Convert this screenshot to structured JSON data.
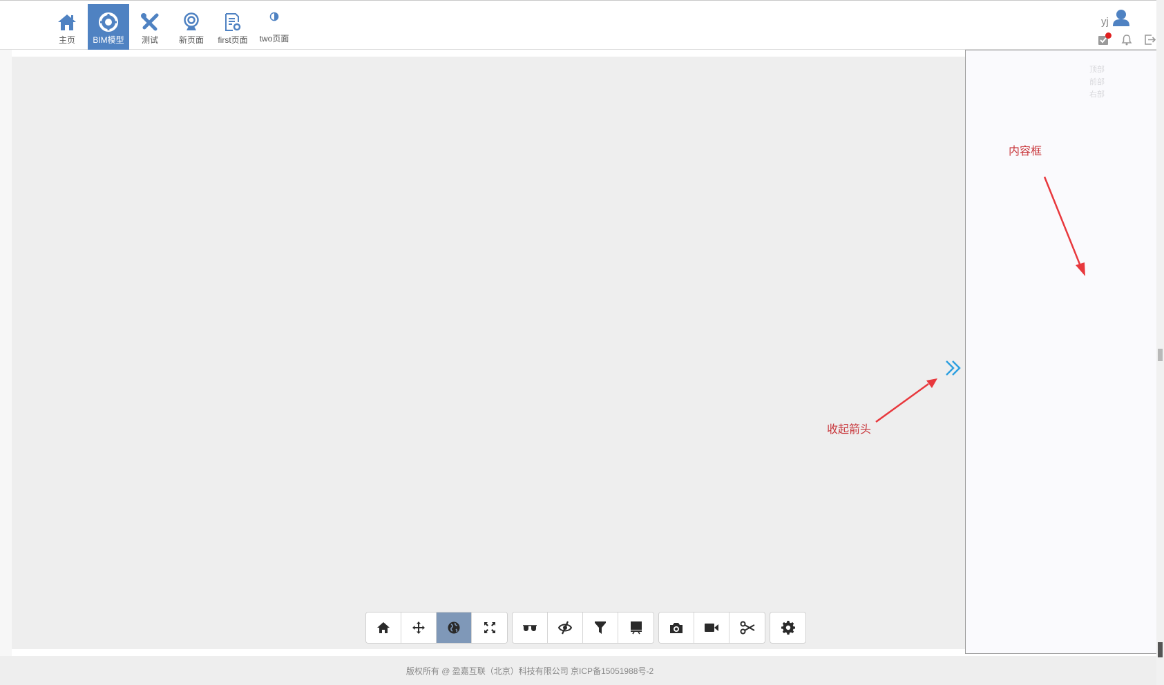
{
  "nav": {
    "items": [
      {
        "label": "主页",
        "icon": "home-icon",
        "active": false
      },
      {
        "label": "BIM模型",
        "icon": "lifebuoy-icon",
        "active": true
      },
      {
        "label": "测试",
        "icon": "tools-cross-icon",
        "active": false
      },
      {
        "label": "新页面",
        "icon": "webcam-icon",
        "active": false
      },
      {
        "label": "first页面",
        "icon": "document-gear-icon",
        "active": false
      },
      {
        "label": "two页面",
        "icon": "contrast-icon",
        "active": false
      }
    ]
  },
  "user": {
    "name": "yj",
    "avatar_icon": "user-icon",
    "task_icon": "task-check-icon",
    "bell_icon": "bell-icon",
    "logout_icon": "logout-icon",
    "notification_dot_color": "#e02020"
  },
  "right_panel": {
    "tools": [
      "顶部",
      "前部",
      "右部"
    ]
  },
  "annotations": {
    "content_box": "内容框",
    "collapse_arrow": "收起箭头",
    "color": "#e8383d"
  },
  "toolbar": {
    "groups": [
      [
        {
          "icon": "home-icon",
          "active": false
        },
        {
          "icon": "move-arrows-icon",
          "active": false
        },
        {
          "icon": "globe-icon",
          "active": true
        },
        {
          "icon": "fullscreen-icon",
          "active": false
        }
      ],
      [
        {
          "icon": "glasses-icon",
          "active": false
        },
        {
          "icon": "eye-slash-icon",
          "active": false
        },
        {
          "icon": "filter-icon",
          "active": false
        },
        {
          "icon": "presentation-icon",
          "active": false
        }
      ],
      [
        {
          "icon": "camera-icon",
          "active": false
        },
        {
          "icon": "video-camera-icon",
          "active": false
        },
        {
          "icon": "scissors-icon",
          "active": false
        }
      ],
      [
        {
          "icon": "gear-icon",
          "active": false
        }
      ]
    ]
  },
  "footer": {
    "copyright": "版权所有 @ 盈嘉互联（北京）科技有限公司 京ICP备15051988号-2"
  },
  "colors": {
    "brand": "#4f82c2",
    "collapse_arrow": "#2fa0e0",
    "toolbar_active": "#7f98b8"
  }
}
